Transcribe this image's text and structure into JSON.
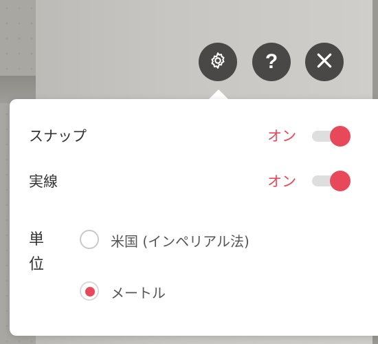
{
  "toolbar": {
    "settings_icon": "gear-icon",
    "help_label": "?",
    "close_icon": "close-icon"
  },
  "settings": {
    "snap": {
      "label": "スナップ",
      "state": "オン",
      "enabled": true
    },
    "solid_line": {
      "label": "実線",
      "state": "オン",
      "enabled": true
    },
    "units": {
      "label": "単位",
      "options": [
        {
          "label": "米国 (インペリアル法)",
          "selected": false
        },
        {
          "label": "メートル",
          "selected": true
        }
      ]
    }
  },
  "colors": {
    "accent": "#e8495a",
    "icon_button_bg": "#4a4846",
    "panel_bg": "#ffffff",
    "toggle_track": "#dedede"
  }
}
